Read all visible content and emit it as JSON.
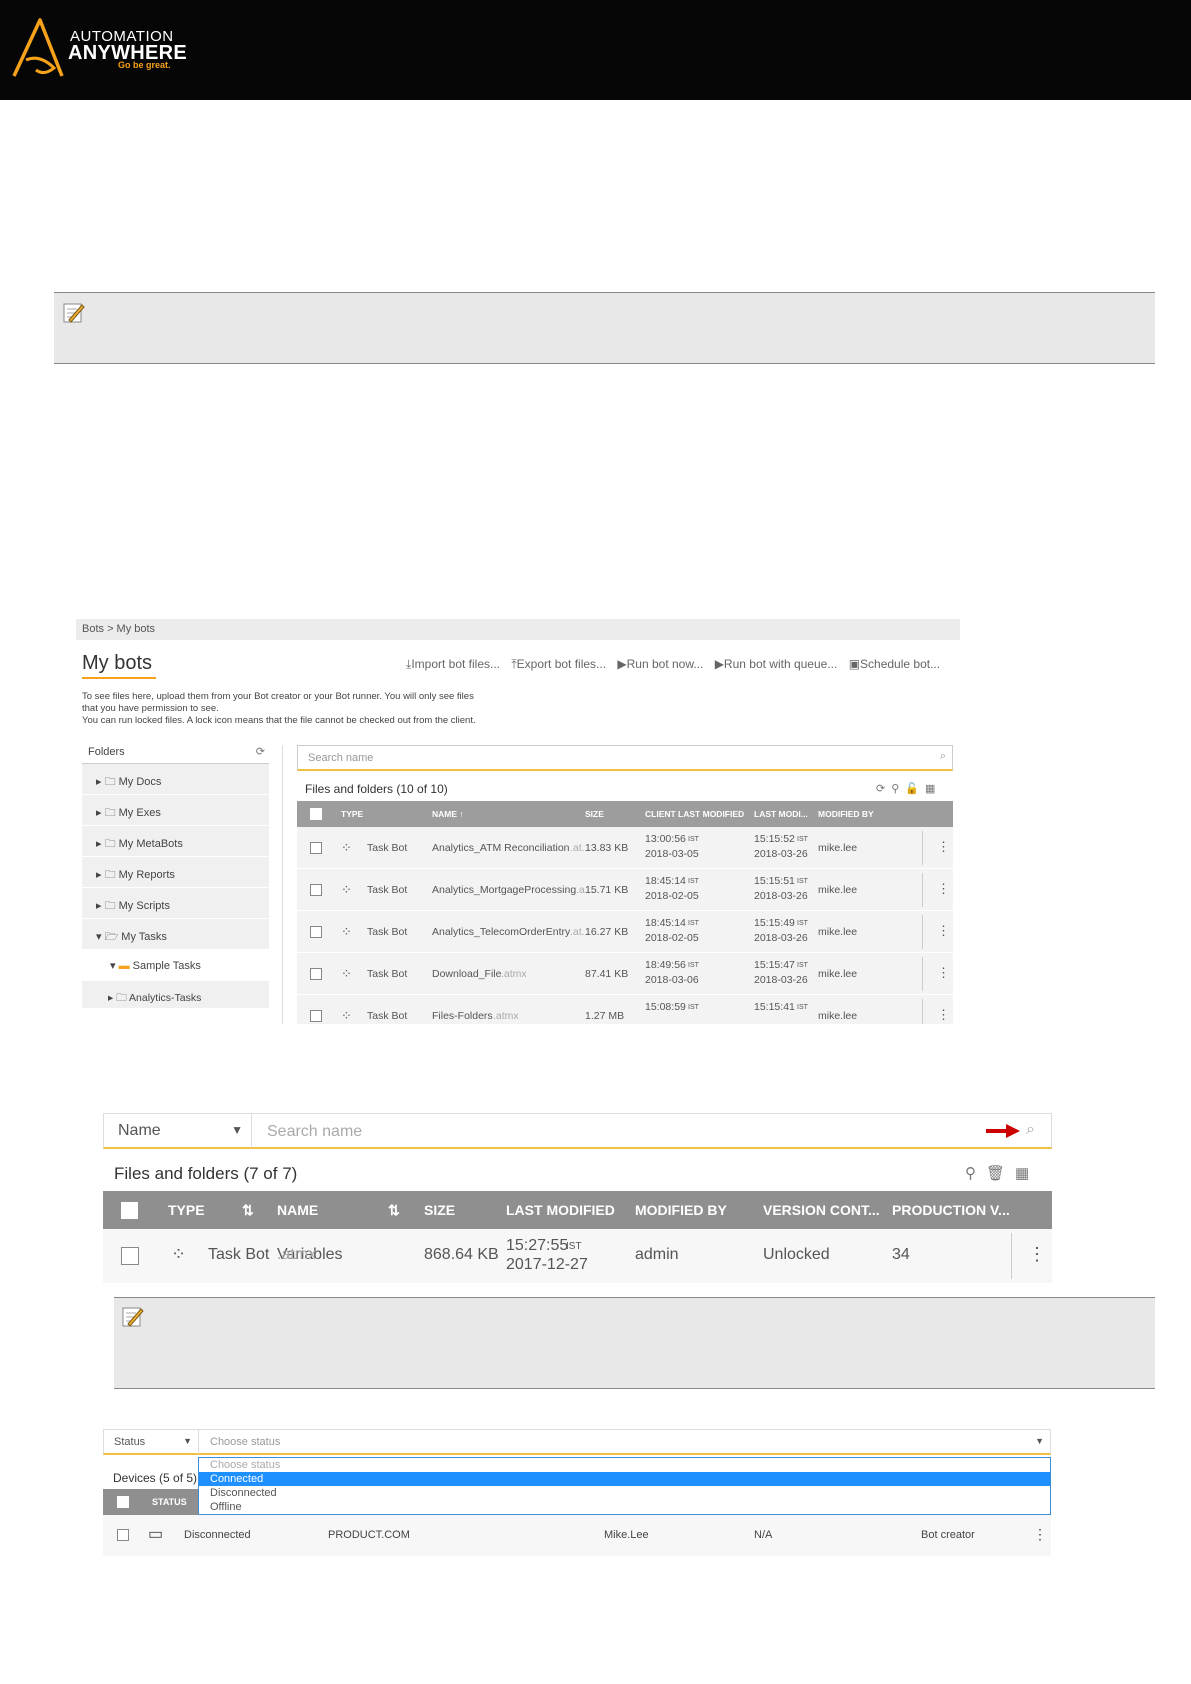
{
  "brand": {
    "line1": "AUTOMATION",
    "line2": "ANYWHERE",
    "tagline": "Go be great.",
    "accent_color": "#f7a21b"
  },
  "note_icon": "pencil-note-icon",
  "shot1": {
    "breadcrumb": "Bots  >  My bots",
    "title": "My bots",
    "actions": [
      "Import bot files...",
      "Export bot files...",
      "Run bot now...",
      "Run bot with queue...",
      "Schedule bot..."
    ],
    "description": [
      "To see files here, upload them from your Bot creator or your Bot runner. You will only see files",
      "that you have permission to see.",
      "You can run locked files. A lock icon means that the file cannot be checked out from the client."
    ],
    "folders_label": "Folders",
    "folders": [
      "My Docs",
      "My Exes",
      "My MetaBots",
      "My Reports",
      "My Scripts",
      "My Tasks"
    ],
    "open_folder": "Sample Tasks",
    "sub_folder": "Analytics-Tasks",
    "search_placeholder": "Search name",
    "count": "Files and folders  (10 of 10)",
    "columns": [
      "TYPE",
      "NAME ↑",
      "SIZE",
      "CLIENT LAST MODIFIED",
      "LAST MODI...",
      "MODIFIED BY"
    ],
    "rows": [
      {
        "type": "Task Bot",
        "name": "Analytics_ATM Reconciliation",
        "ext": ".at...",
        "size": "13.83 KB",
        "client_time": "13:00:56",
        "client_date": "2018-03-05",
        "mod_time": "15:15:52",
        "mod_date": "2018-03-26",
        "by": "mike.lee"
      },
      {
        "type": "Task Bot",
        "name": "Analytics_MortgageProcessing",
        "ext": ".a...",
        "size": "15.71 KB",
        "client_time": "18:45:14",
        "client_date": "2018-02-05",
        "mod_time": "15:15:51",
        "mod_date": "2018-03-26",
        "by": "mike.lee"
      },
      {
        "type": "Task Bot",
        "name": "Analytics_TelecomOrderEntry",
        "ext": ".at...",
        "size": "16.27 KB",
        "client_time": "18:45:14",
        "client_date": "2018-02-05",
        "mod_time": "15:15:49",
        "mod_date": "2018-03-26",
        "by": "mike.lee"
      },
      {
        "type": "Task Bot",
        "name": "Download_File",
        "ext": ".atmx",
        "size": "87.41 KB",
        "client_time": "18:49:56",
        "client_date": "2018-03-06",
        "mod_time": "15:15:47",
        "mod_date": "2018-03-26",
        "by": "mike.lee"
      },
      {
        "type": "Task Bot",
        "name": "Files-Folders",
        "ext": ".atmx",
        "size": "1.27 MB",
        "client_time": "15:08:59",
        "client_date": "",
        "mod_time": "15:15:41",
        "mod_date": "",
        "by": "mike.lee"
      }
    ],
    "tz": "IST"
  },
  "shot2": {
    "filter_field": "Name",
    "search_placeholder": "Search name",
    "count": "Files and folders (7 of 7)",
    "columns": [
      "TYPE",
      "NAME",
      "SIZE",
      "LAST MODIFIED",
      "MODIFIED BY",
      "VERSION CONT...",
      "PRODUCTION V..."
    ],
    "row": {
      "type": "Task Bot",
      "name": "Variables",
      "ext": ".atmx",
      "size": "868.64 KB",
      "time": "15:27:55",
      "tz": "IST",
      "date": "2017-12-27",
      "by": "admin",
      "version": "Unlocked",
      "production": "34"
    },
    "arrow_color": "#cc0000"
  },
  "shot3": {
    "filter_field": "Status",
    "placeholder": "Choose status",
    "options": [
      "Choose status",
      "Connected",
      "Disconnected",
      "Offline"
    ],
    "selected_option": "Connected",
    "count": "Devices (5 of 5)",
    "status_col": "STATUS",
    "row": {
      "status": "Disconnected",
      "host": "PRODUCT.COM",
      "user": "Mike.Lee",
      "na": "N/A",
      "role": "Bot creator"
    }
  }
}
